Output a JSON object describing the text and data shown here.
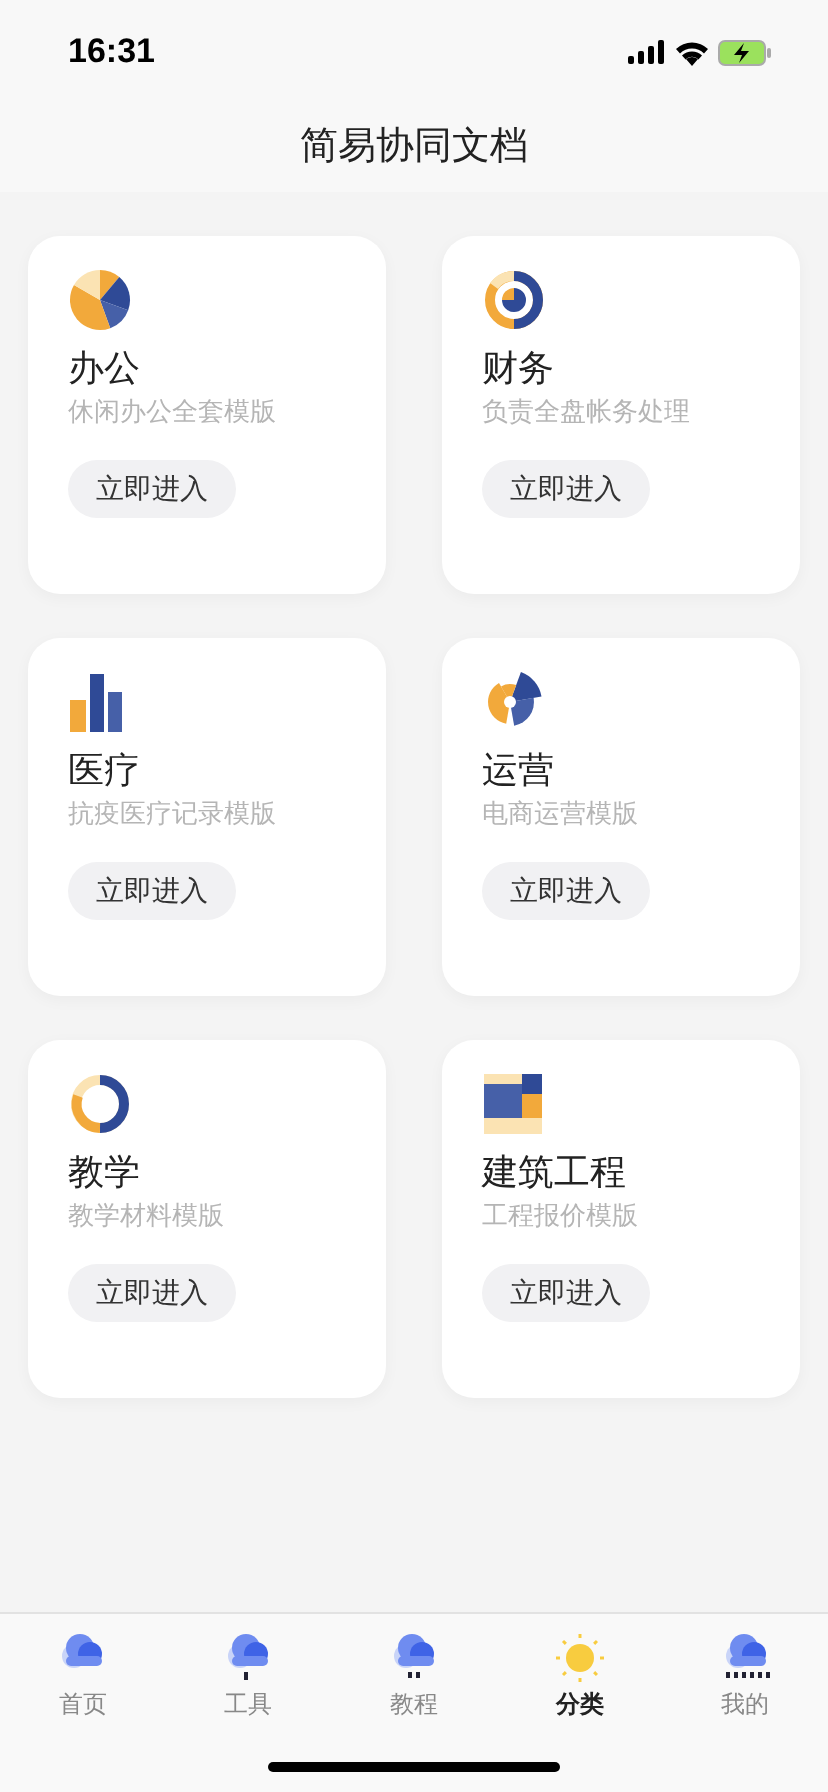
{
  "status_bar": {
    "time": "16:31"
  },
  "header": {
    "title": "简易协同文档"
  },
  "cards": [
    {
      "title": "办公",
      "subtitle": "休闲办公全套模版",
      "button": "立即进入"
    },
    {
      "title": "财务",
      "subtitle": "负责全盘帐务处理",
      "button": "立即进入"
    },
    {
      "title": "医疗",
      "subtitle": "抗疫医疗记录模版",
      "button": "立即进入"
    },
    {
      "title": "运营",
      "subtitle": "电商运营模版",
      "button": "立即进入"
    },
    {
      "title": "教学",
      "subtitle": "教学材料模版",
      "button": "立即进入"
    },
    {
      "title": "建筑工程",
      "subtitle": "工程报价模版",
      "button": "立即进入"
    }
  ],
  "tab_bar": [
    {
      "label": "首页",
      "selected": false
    },
    {
      "label": "工具",
      "selected": false
    },
    {
      "label": "教程",
      "selected": false
    },
    {
      "label": "分类",
      "selected": true
    },
    {
      "label": "我的",
      "selected": false
    }
  ]
}
